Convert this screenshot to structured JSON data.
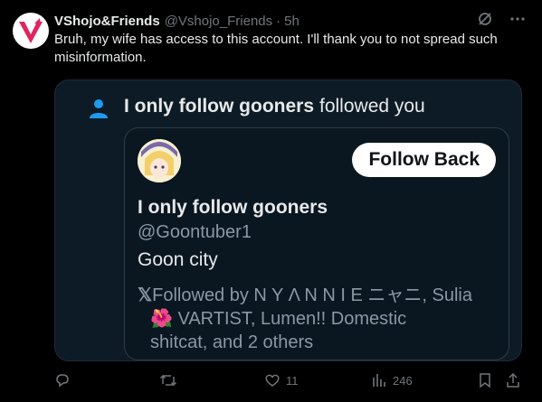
{
  "author": {
    "display_name": "VShojo&Friends",
    "handle": "@Vshojo_Friends",
    "separator": "·",
    "time": "5h",
    "avatar_icon": "vshojo-logo",
    "brand_color": "#e0245e"
  },
  "tweet": {
    "text": "Bruh, my wife has access to this account. I'll thank you to not spread such misinformation."
  },
  "quoted_image": {
    "notification": {
      "icon": "person-icon",
      "name": "I only follow gooners",
      "text": "followed you",
      "icon_color": "#1d9bf0"
    },
    "profile": {
      "name": "I only follow gooners",
      "handle": "@Goontuber1",
      "bio": "Goon city",
      "follow_button": "Follow Back",
      "followed_by_line1": "Followed by N Y Λ N N I E ニャニ, Sulia",
      "followed_by_line2": "🌺 VARTIST, Lumen!! Domestic",
      "followed_by_line3": "shitcat, and 2 others",
      "x_glyph": "𝕏"
    }
  },
  "actions": {
    "reply_count": "",
    "retweet_count": "",
    "like_count": "11",
    "views_count": "246"
  }
}
